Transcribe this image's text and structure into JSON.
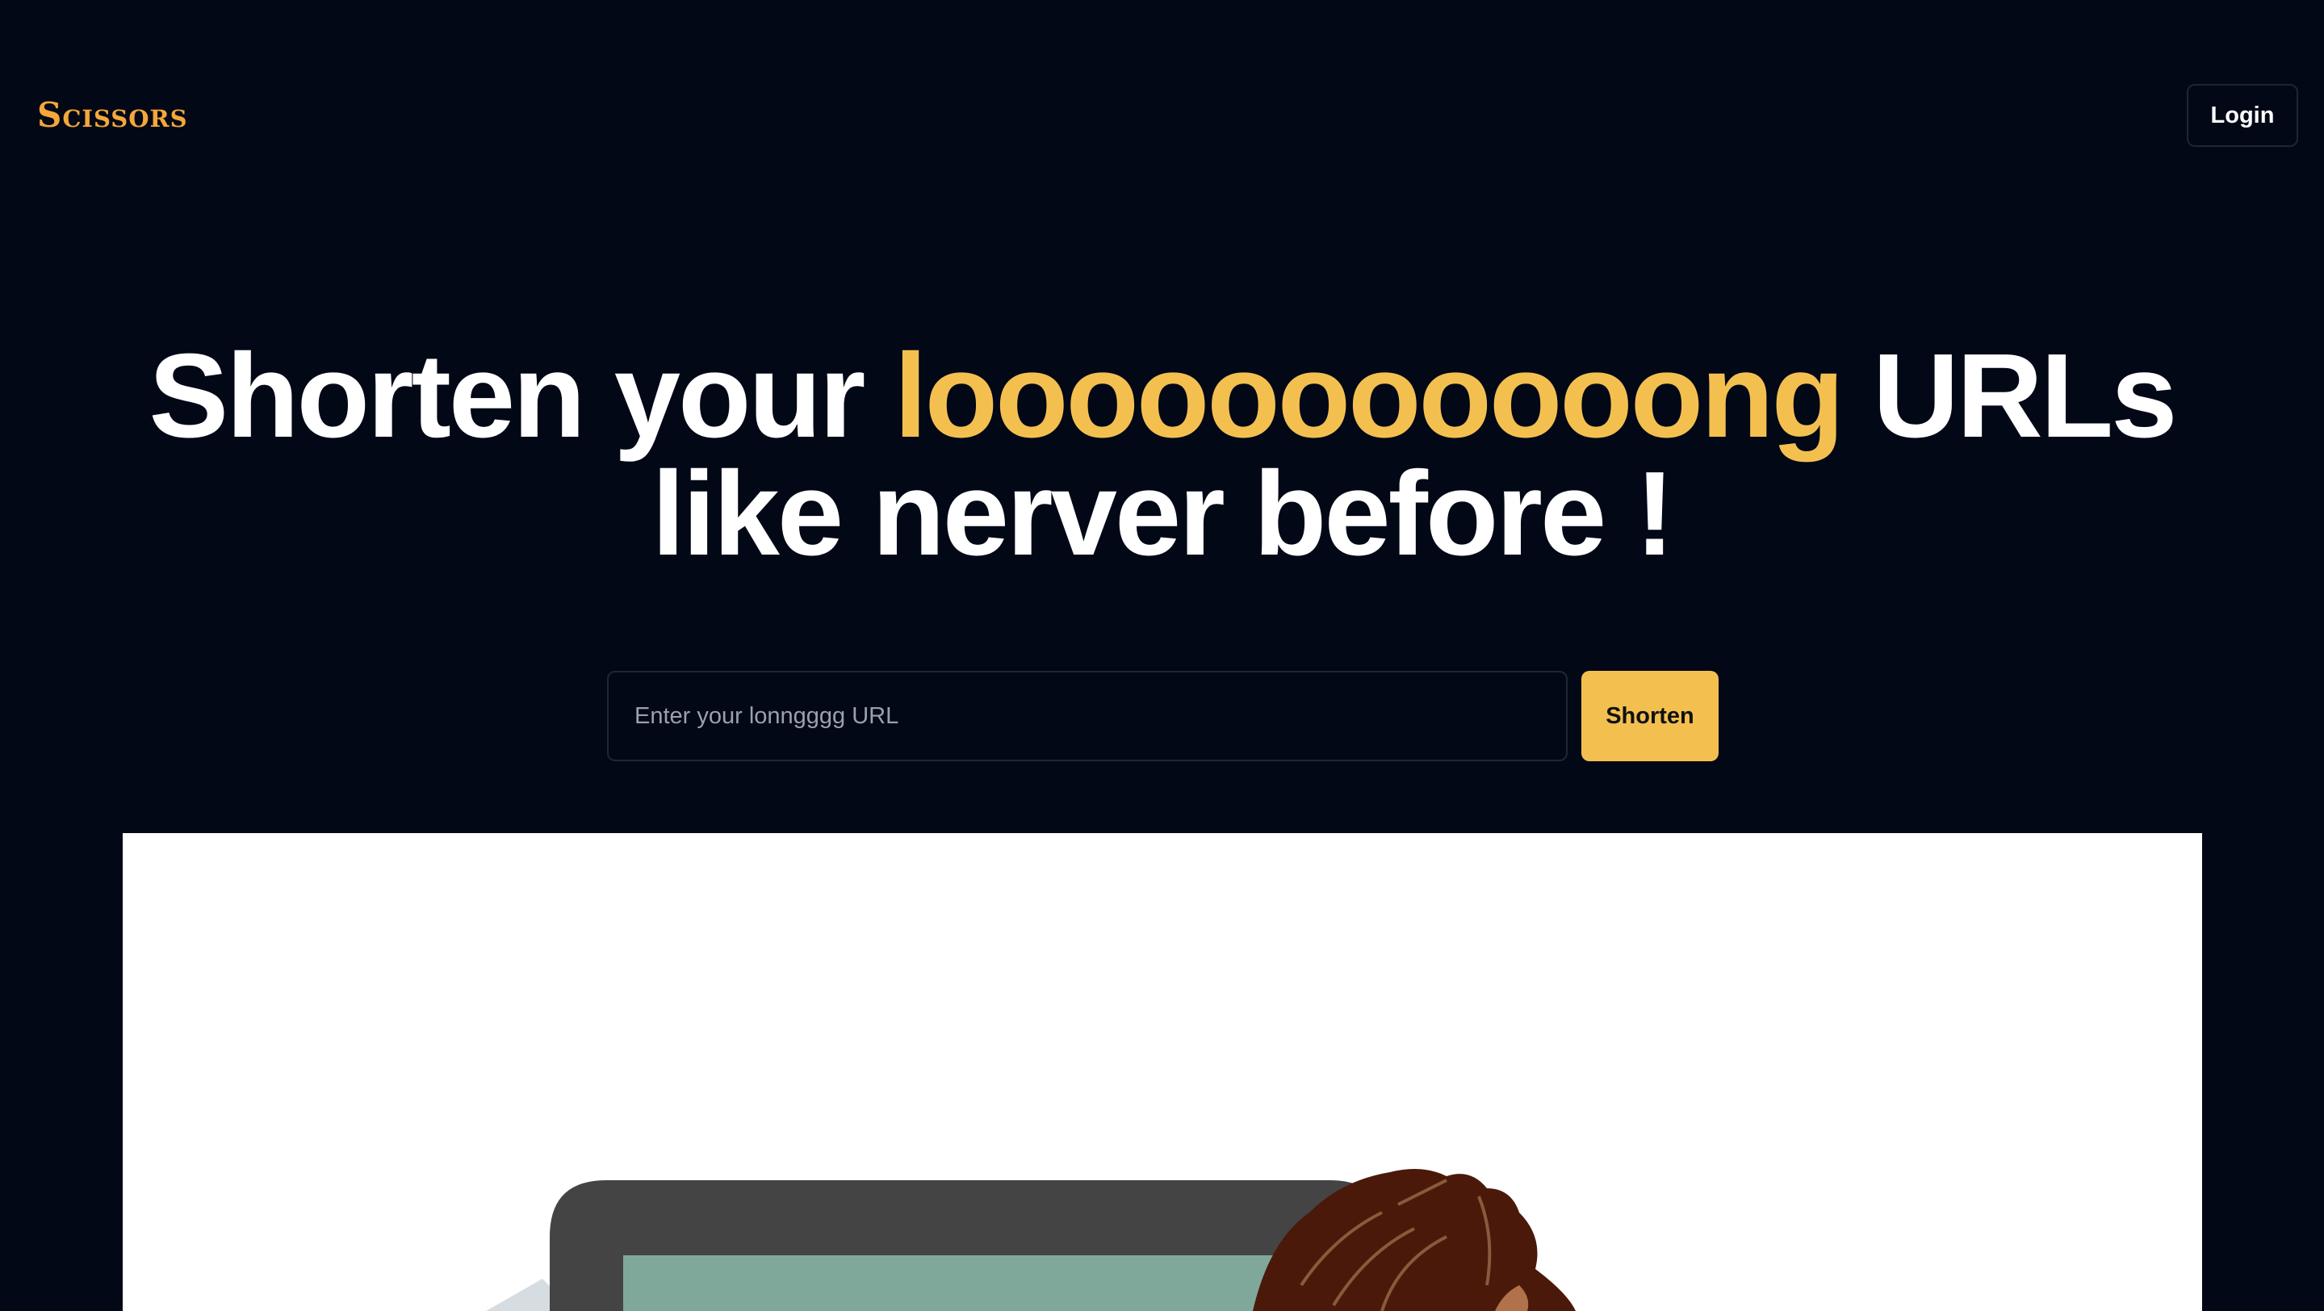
{
  "nav": {
    "logo_text": "Scissors",
    "login_label": "Login"
  },
  "hero": {
    "title_part1": "Shorten your ",
    "title_accent": "looooooooooong",
    "title_part2": " URLs",
    "title_line2": "like nerver before !"
  },
  "form": {
    "input_placeholder": "Enter your lonngggg URL",
    "input_value": "",
    "submit_label": "Shorten"
  },
  "colors": {
    "background": "#030817",
    "accent": "#f3c050",
    "logo": "#f4a73a"
  },
  "illustration": {
    "icon": "person-with-laptop-illustration"
  }
}
